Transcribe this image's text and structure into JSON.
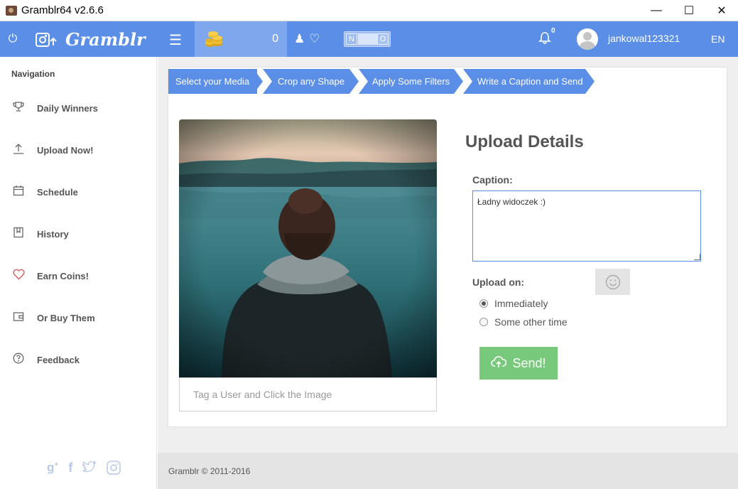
{
  "window": {
    "title": "Gramblr64 v2.6.6"
  },
  "topbar": {
    "logo": "Gramblr",
    "coins": "0",
    "toggle_on": "N",
    "toggle_off": "O",
    "notification_count": "0",
    "username": "jankowal123321",
    "language": "EN"
  },
  "sidebar": {
    "title": "Navigation",
    "items": [
      {
        "label": "Daily Winners",
        "icon": "trophy-icon"
      },
      {
        "label": "Upload Now!",
        "icon": "upload-icon"
      },
      {
        "label": "Schedule",
        "icon": "calendar-icon"
      },
      {
        "label": "History",
        "icon": "bookmark-icon"
      },
      {
        "label": "Earn Coins!",
        "icon": "heart-icon"
      },
      {
        "label": "Or Buy Them",
        "icon": "wallet-icon"
      },
      {
        "label": "Feedback",
        "icon": "question-icon"
      }
    ],
    "heart_color": "#e05555"
  },
  "steps": [
    "Select your Media",
    "Crop any Shape",
    "Apply Some Filters",
    "Write a Caption and Send"
  ],
  "upload": {
    "tag_placeholder": "Tag a User and Click the Image",
    "title": "Upload Details",
    "caption_label": "Caption:",
    "caption_value": "Ładny widoczek :)",
    "upload_on_label": "Upload on:",
    "options": [
      "Immediately",
      "Some other time"
    ],
    "selected_option": "Immediately",
    "send_label": "Send!"
  },
  "footer": {
    "copyright": "Gramblr © 2011-2016"
  },
  "colors": {
    "accent": "#5b8ee6",
    "send": "#79c97c"
  }
}
